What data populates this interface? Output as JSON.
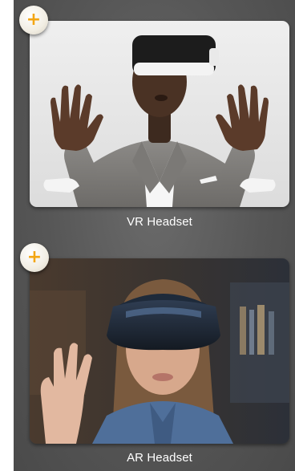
{
  "items": [
    {
      "label": "VR Headset",
      "add_icon": "plus-icon",
      "accent_color": "#f3a614"
    },
    {
      "label": "AR Headset",
      "add_icon": "plus-icon",
      "accent_color": "#f3a614"
    }
  ],
  "add_button_glyph": "+"
}
